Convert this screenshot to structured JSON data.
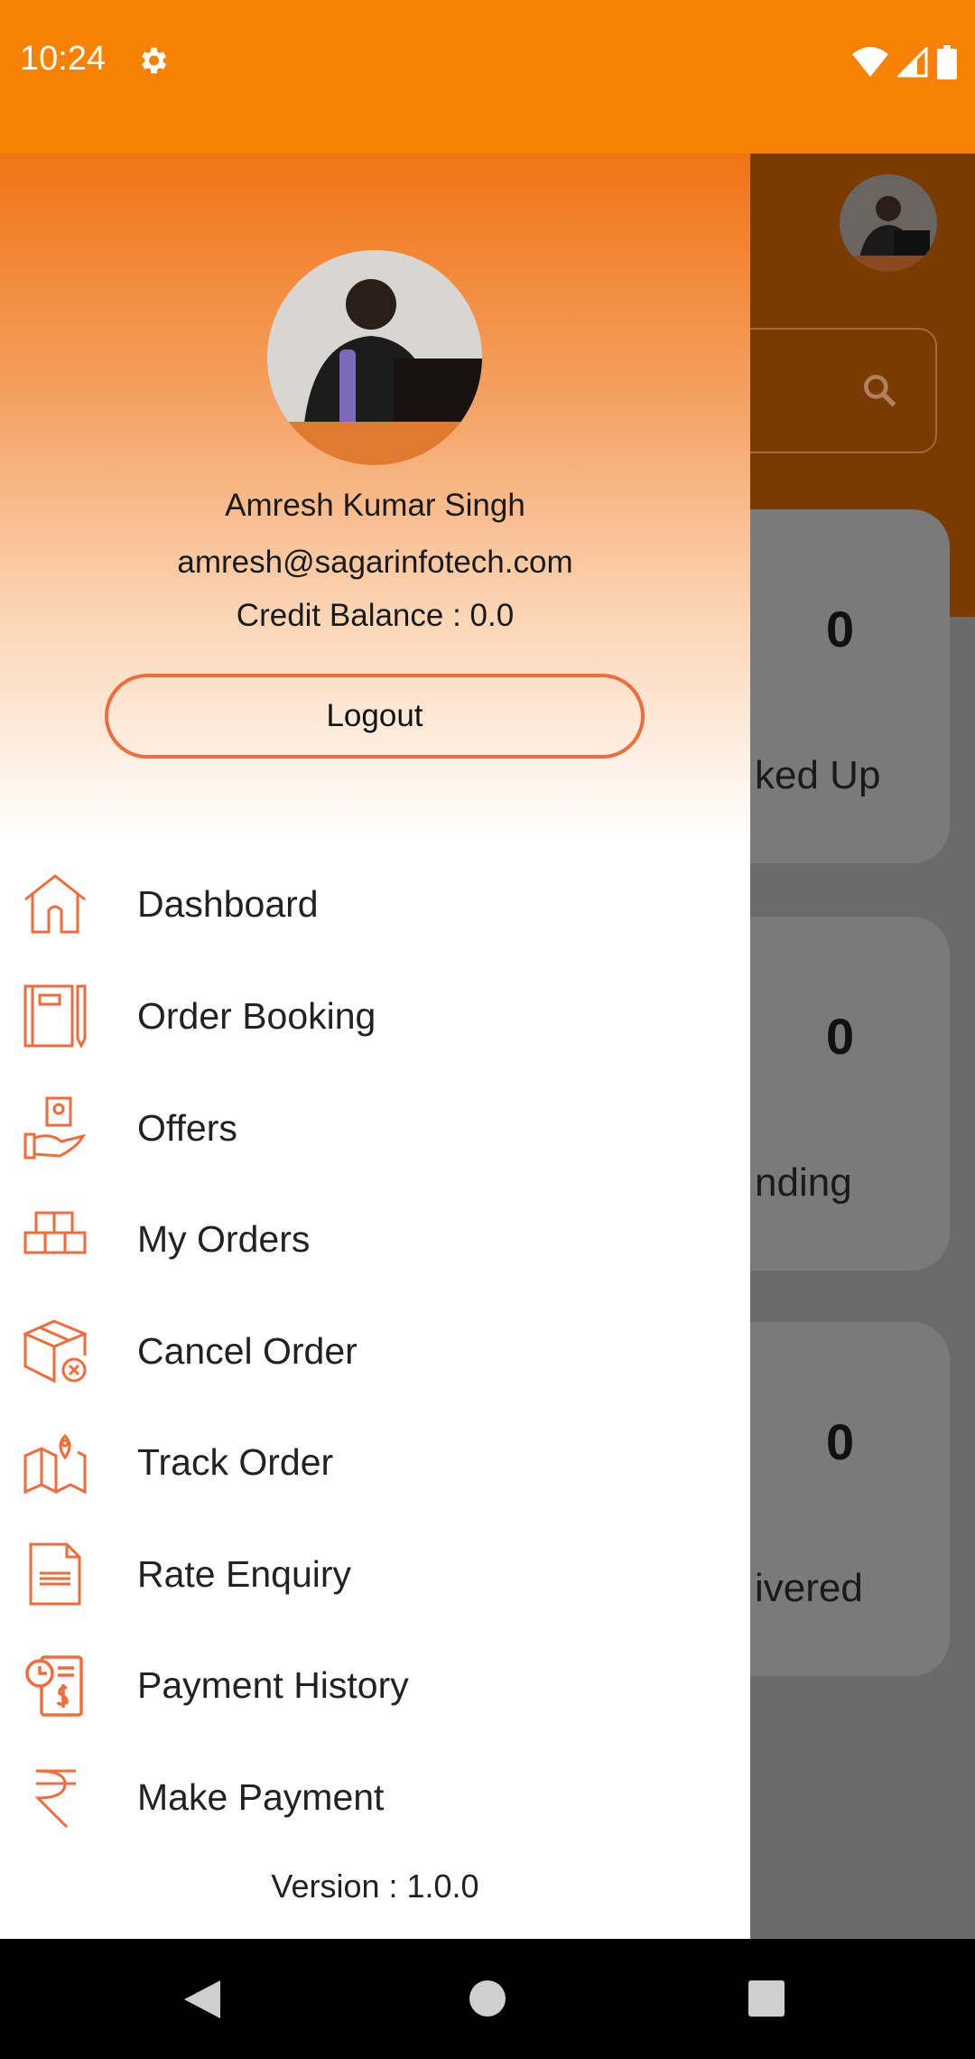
{
  "status_bar": {
    "time": "10:24",
    "icons": [
      "settings-icon",
      "wifi-icon",
      "signal-icon",
      "battery-icon"
    ]
  },
  "background": {
    "cards": [
      {
        "count": "0",
        "label": "ked Up"
      },
      {
        "count": "0",
        "label": "nding"
      },
      {
        "count": "0",
        "label": "ivered"
      }
    ]
  },
  "drawer": {
    "user_name": "Amresh Kumar Singh",
    "email": "amresh@sagarinfotech.com",
    "credit_balance": "Credit Balance : 0.0",
    "logout_label": "Logout",
    "menu": [
      {
        "label": "Dashboard",
        "icon": "home-icon"
      },
      {
        "label": "Order Booking",
        "icon": "notebook-icon"
      },
      {
        "label": "Offers",
        "icon": "offer-hand-icon"
      },
      {
        "label": "My Orders",
        "icon": "boxes-icon"
      },
      {
        "label": "Cancel Order",
        "icon": "box-cancel-icon"
      },
      {
        "label": "Track Order",
        "icon": "map-pin-icon"
      },
      {
        "label": "Rate Enquiry",
        "icon": "document-icon"
      },
      {
        "label": "Payment History",
        "icon": "payment-history-icon"
      },
      {
        "label": "Make Payment",
        "icon": "rupee-icon"
      }
    ],
    "version": "Version : 1.0.0"
  },
  "colors": {
    "accent": "#f26b3a",
    "status_bar": "#f78102"
  }
}
